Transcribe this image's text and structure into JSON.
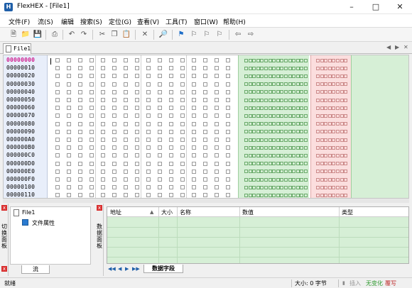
{
  "window": {
    "title": "FlexHEX - [File1]",
    "app_icon": "flexhex-app-icon"
  },
  "menu": [
    {
      "label": "文件(F)"
    },
    {
      "label": "流(S)"
    },
    {
      "label": "编辑"
    },
    {
      "label": "搜索(S)"
    },
    {
      "label": "定位(G)"
    },
    {
      "label": "查看(V)"
    },
    {
      "label": "工具(T)"
    },
    {
      "label": "窗口(W)"
    },
    {
      "label": "帮助(H)"
    }
  ],
  "toolbar": [
    "new-file-icon",
    "open-folder-icon",
    "save-icon",
    "print-icon",
    "undo-icon",
    "redo-icon",
    "cut-icon",
    "copy-icon",
    "paste-icon",
    "delete-icon",
    "find-icon",
    "bookmark-flag-icon",
    "bookmark-prev-icon",
    "bookmark-next-icon",
    "bookmark-clear-icon",
    "back-arrow-icon",
    "forward-arrow-icon"
  ],
  "document_tab": {
    "label": "File1"
  },
  "editor": {
    "addresses": [
      "00000000",
      "00000010",
      "00000020",
      "00000030",
      "00000040",
      "00000050",
      "00000060",
      "00000070",
      "00000080",
      "00000090",
      "000000A0",
      "000000B0",
      "000000C0",
      "000000D0",
      "000000E0",
      "000000F0",
      "00000100",
      "00000110"
    ],
    "selected_address_color": "#d02090",
    "ascii_bg": "#d6efd6",
    "ascii2_bg": "#fbdede"
  },
  "left_panel": {
    "vertical_label": "切换面板",
    "tree_root": "File1",
    "tree_child": "文件属性",
    "tab": "流"
  },
  "right_panel": {
    "vertical_label": "数据面板",
    "columns": [
      "地址",
      "大小",
      "名称",
      "数值",
      "类型"
    ],
    "tab": "数据字段"
  },
  "status": {
    "left": "就绪",
    "size_label": "大小: 0 字节",
    "mode1": "插入",
    "mode2": "无变化",
    "mode3": "覆写",
    "mode2_color": "#2e9a2e",
    "mode3_color": "#c03030"
  }
}
